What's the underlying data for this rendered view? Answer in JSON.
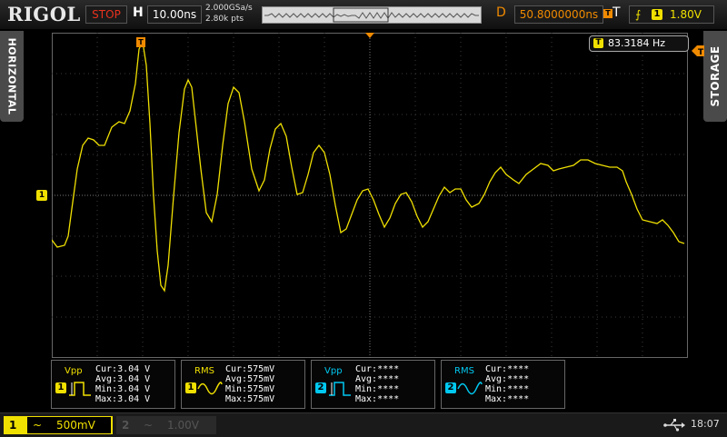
{
  "brand": "RIGOL",
  "run_state": "STOP",
  "horizontal": {
    "label": "H",
    "timebase": "10.00ns",
    "sample_rate": "2.000GSa/s",
    "points": "2.80k pts"
  },
  "delay": {
    "label": "D",
    "value": "50.8000000ns"
  },
  "trigger": {
    "label": "T",
    "channel": "1",
    "level": "1.80V"
  },
  "side_tabs": {
    "left": "HORIZONTAL",
    "right": "STORAGE"
  },
  "frequency": {
    "channel": "T",
    "value": "83.3184 Hz"
  },
  "markers": {
    "trigger_position": "T",
    "channel1_ground": "1"
  },
  "measurements": [
    {
      "name": "Vpp",
      "channel": "1",
      "cur": "Cur:3.04 V",
      "avg": "Avg:3.04 V",
      "min": "Min:3.04 V",
      "max": "Max:3.04 V"
    },
    {
      "name": "RMS",
      "channel": "1",
      "cur": "Cur:575mV",
      "avg": "Avg:575mV",
      "min": "Min:575mV",
      "max": "Max:575mV"
    },
    {
      "name": "Vpp",
      "channel": "2",
      "cur": "Cur:****",
      "avg": "Avg:****",
      "min": "Min:****",
      "max": "Max:****"
    },
    {
      "name": "RMS",
      "channel": "2",
      "cur": "Cur:****",
      "avg": "Avg:****",
      "min": "Min:****",
      "max": "Max:****"
    }
  ],
  "channels": [
    {
      "number": "1",
      "coupling": "~",
      "scale": "500mV",
      "active": true
    },
    {
      "number": "2",
      "coupling": "~",
      "scale": "1.00V",
      "active": false
    }
  ],
  "clock": "18:07",
  "colors": {
    "ch1": "#f0e000",
    "ch2": "#00c8f0",
    "trigger": "#f08a00",
    "stop": "#e8321e"
  }
}
